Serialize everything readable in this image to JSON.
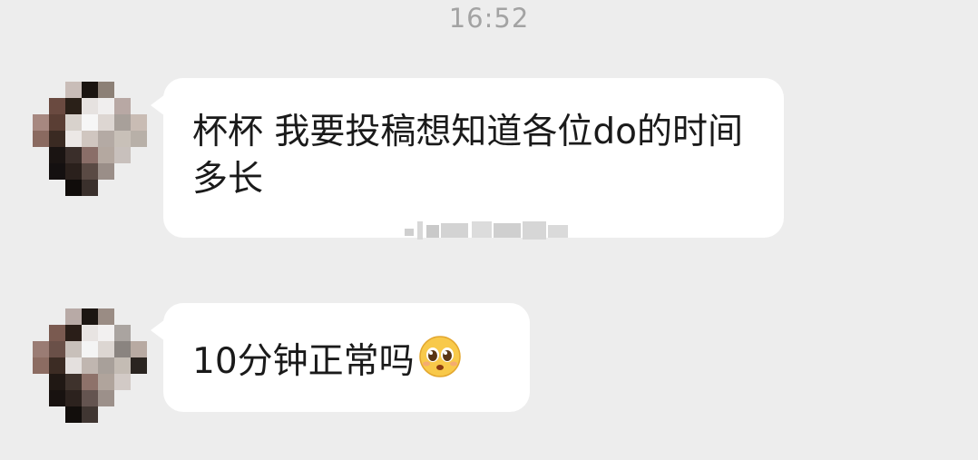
{
  "status": {
    "time": "16:52"
  },
  "messages": [
    {
      "sender": "other",
      "text": "杯杯 我要投稿想知道各位do的时间多长",
      "has_watermark": true
    },
    {
      "sender": "other",
      "text": "10分钟正常吗",
      "emoji": "pleading-face-emoji"
    }
  ],
  "colors": {
    "background": "#ededed",
    "bubble": "#ffffff",
    "text": "#1a1a1a",
    "time_text": "#a3a3a3"
  }
}
